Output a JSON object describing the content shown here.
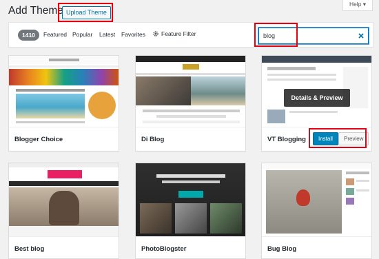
{
  "header": {
    "title": "Add Themes",
    "upload_label": "Upload Theme",
    "help_label": "Help ▾"
  },
  "filters": {
    "count": "1410",
    "tabs": [
      "Featured",
      "Popular",
      "Latest",
      "Favorites"
    ],
    "feature_filter": "Feature Filter",
    "search_value": "blog"
  },
  "themes": [
    {
      "name": "Blogger Choice"
    },
    {
      "name": "Di Blog"
    },
    {
      "name": "VT Blogging",
      "overlay": "Details & Preview",
      "install": "Install",
      "preview": "Preview"
    },
    {
      "name": "Best blog"
    },
    {
      "name": "PhotoBlogster"
    },
    {
      "name": "Bug Blog"
    }
  ],
  "colors": {
    "accent": "#0073aa",
    "highlight": "#e3000f",
    "primary_button": "#0085ba"
  }
}
